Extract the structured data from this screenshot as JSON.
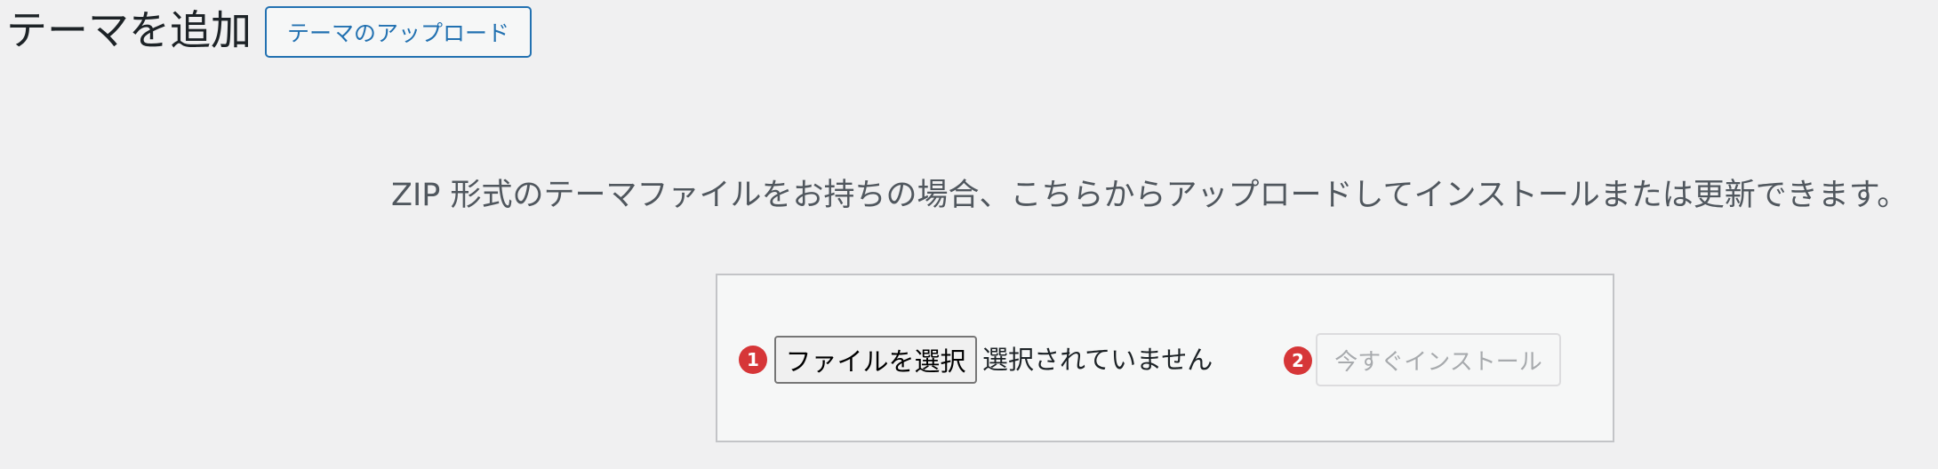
{
  "header": {
    "title": "テーマを追加",
    "upload_button_label": "テーマのアップロード"
  },
  "upload": {
    "help_text": "ZIP 形式のテーマファイルをお持ちの場合、こちらからアップロードしてインストールまたは更新できます。",
    "step1_badge": "1",
    "file_button_label": "ファイルを選択",
    "file_status": "選択されていません",
    "step2_badge": "2",
    "install_button_label": "今すぐインストール",
    "install_button_disabled": true
  },
  "colors": {
    "accent": "#2271b1",
    "badge": "#d63638",
    "background": "#f0f0f1",
    "box_background": "#f6f7f7",
    "disabled_text": "#a7aaad"
  },
  "icons": {
    "step1": "number-one-badge-icon",
    "step2": "number-two-badge-icon"
  }
}
